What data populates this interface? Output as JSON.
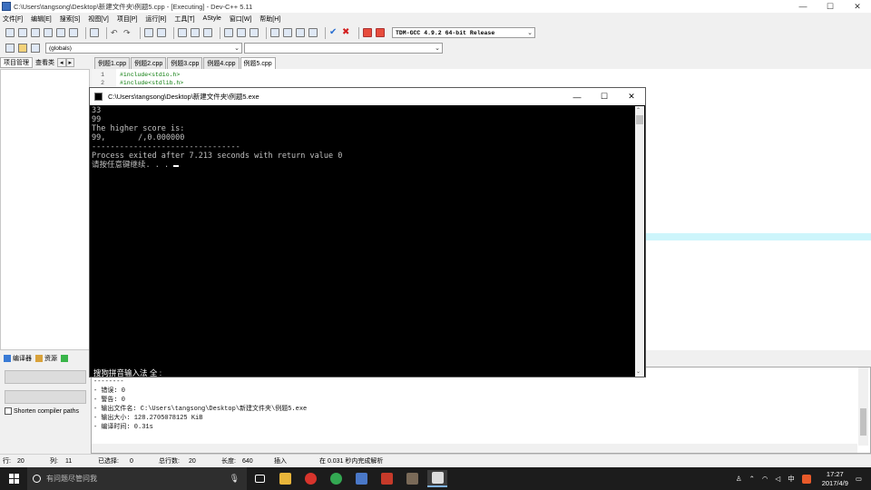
{
  "window": {
    "title": "C:\\Users\\tangsong\\Desktop\\新建文件夹\\例题5.cpp - [Executing] - Dev-C++ 5.11"
  },
  "menu": [
    "文件[F]",
    "编辑[E]",
    "搜索[S]",
    "视图[V]",
    "项目[P]",
    "运行[R]",
    "工具[T]",
    "AStyle",
    "窗口[W]",
    "帮助[H]"
  ],
  "toolbar": {
    "compiler": "TDM-GCC 4.9.2 64-bit Release",
    "scope": "(globals)"
  },
  "left_tabs": [
    "项目管理",
    "查看类"
  ],
  "file_tabs": [
    "例题1.cpp",
    "例题2.cpp",
    "例题3.cpp",
    "例题4.cpp",
    "例题5.cpp"
  ],
  "editor": {
    "lines": [
      {
        "num": "1",
        "code": "#include<stdio.h>"
      },
      {
        "num": "2",
        "code": "#include<stdlib.h>"
      }
    ]
  },
  "console": {
    "title": "C:\\Users\\tangsong\\Desktop\\新建文件夹\\例题5.exe",
    "lines": [
      "33",
      "99",
      "The higher score is:",
      "99,       /,0.000000",
      "--------------------------------",
      "Process exited after 7.213 seconds with return value 0",
      "请按任意键继续. . . "
    ],
    "ime": "搜狗拼音输入法 全 :"
  },
  "bottom_tabs": [
    "编译器",
    "资源"
  ],
  "shorten_label": "Shorten compiler paths",
  "compile_output": [
    "--------",
    "- 错误: 0",
    "- 警告: 0",
    "- 输出文件名: C:\\Users\\tangsong\\Desktop\\新建文件夹\\例题5.exe",
    "- 输出大小: 128.2705078125 KiB",
    "- 编译时间: 0.31s"
  ],
  "status": {
    "row_label": "行:",
    "row": "20",
    "col_label": "列:",
    "col": "11",
    "sel_label": "已选择:",
    "sel": "0",
    "total_label": "总行数:",
    "total": "20",
    "len_label": "长度:",
    "len": "640",
    "mode": "插入",
    "parse": "在 0.031 秒内完成解析"
  },
  "taskbar": {
    "search_placeholder": "有问题尽管问我",
    "time": "17:27",
    "date": "2017/4/9",
    "ime_label": "中"
  }
}
